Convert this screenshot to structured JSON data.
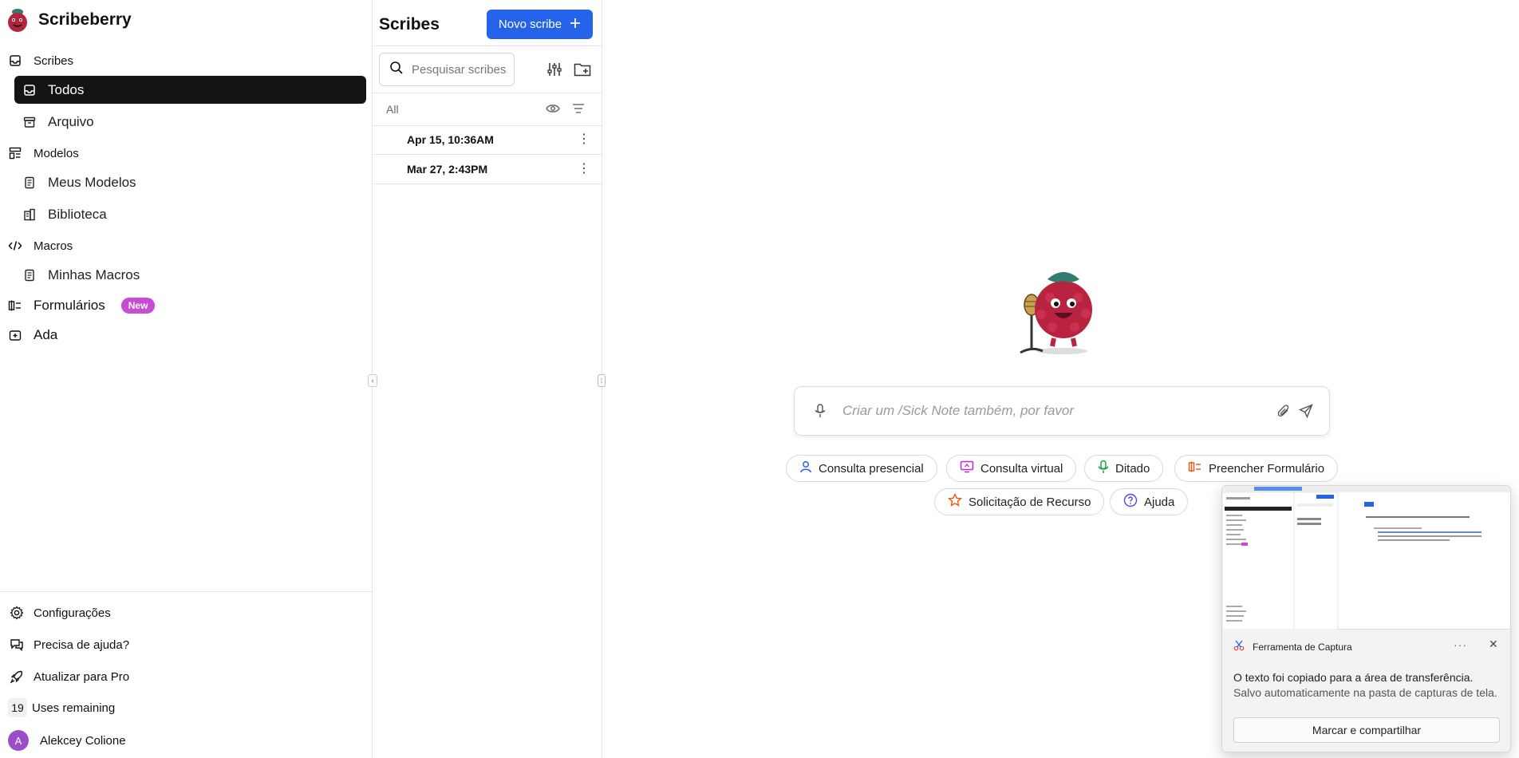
{
  "brand": {
    "title": "Scribeberry"
  },
  "sidebar": {
    "sections": [
      {
        "label": "Scribes",
        "icon": "inbox-icon"
      },
      {
        "label": "Modelos",
        "icon": "layout-icon"
      },
      {
        "label": "Macros",
        "icon": "code-icon"
      }
    ],
    "items": [
      {
        "label": "Todos",
        "icon": "inbox-icon",
        "active": true
      },
      {
        "label": "Arquivo",
        "icon": "archive-icon"
      },
      {
        "label": "Meus Modelos",
        "icon": "document-icon"
      },
      {
        "label": "Biblioteca",
        "icon": "building-icon"
      },
      {
        "label": "Minhas Macros",
        "icon": "document-icon"
      }
    ],
    "forms": {
      "label": "Formulários",
      "badge": "New"
    },
    "ada": {
      "label": "Ada"
    },
    "bottom": {
      "settings": "Configurações",
      "help": "Precisa de ajuda?",
      "upgrade": "Atualizar para Pro",
      "uses_count": "19",
      "uses_label": "Uses remaining",
      "user_initial": "A",
      "user_name": "Alekcey Colione"
    }
  },
  "panel": {
    "title": "Scribes",
    "new_button": "Novo scribe",
    "search_placeholder": "Pesquisar scribes...",
    "filter_label": "All",
    "scribes": [
      "Apr 15, 10:36AM",
      "Mar 27, 2:43PM"
    ]
  },
  "main": {
    "chat_placeholder": "Criar um /Sick Note também, por favor",
    "chips": [
      {
        "label": "Consulta presencial",
        "icon": "user-icon",
        "color": "#2563eb"
      },
      {
        "label": "Consulta virtual",
        "icon": "monitor-icon",
        "color": "#c026d3"
      },
      {
        "label": "Ditado",
        "icon": "mic-icon",
        "color": "#16a34a"
      },
      {
        "label": "Preencher Formulário",
        "icon": "form-icon",
        "color": "#ea580c"
      },
      {
        "label": "Solicitação de Recurso",
        "icon": "star-icon",
        "color": "#ea580c"
      },
      {
        "label": "Ajuda",
        "icon": "question-icon",
        "color": "#4f46e5"
      }
    ]
  },
  "toast": {
    "app_name": "Ferramenta de Captura",
    "message": "O texto foi copiado para a área de transferência.",
    "sub": "Salvo automaticamente na pasta de capturas de tela.",
    "button": "Marcar e compartilhar"
  }
}
